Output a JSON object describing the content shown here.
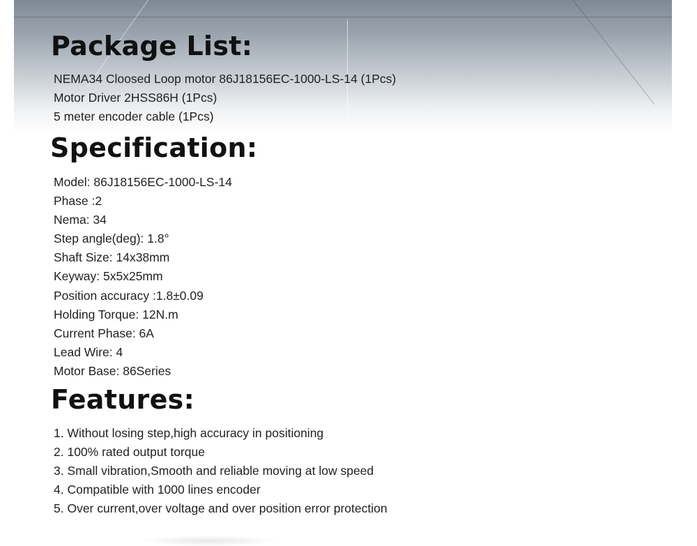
{
  "package": {
    "title": "Package List:",
    "items": [
      "NEMA34 Cloosed Loop motor 86J18156EC-1000-LS-14 (1Pcs)",
      "Motor Driver 2HSS86H (1Pcs)",
      "5 meter encoder cable (1Pcs)"
    ]
  },
  "specification": {
    "title": "Specification:",
    "items": [
      "Model: 86J18156EC-1000-LS-14",
      "Phase :2",
      "Nema: 34",
      "Step angle(deg): 1.8°",
      "Shaft Size: 14x38mm",
      "Keyway: 5x5x25mm",
      "Position accuracy :1.8±0.09",
      "Holding Torque: 12N.m",
      "Current Phase: 6A",
      "Lead Wire: 4",
      "Motor Base: 86Series"
    ]
  },
  "features": {
    "title": "Features:",
    "items": [
      "1. Without losing step,high accuracy in positioning",
      "2. 100% rated output torque",
      "3. Small vibration,Smooth and reliable moving at low speed",
      "4. Compatible with 1000 lines encoder",
      "5. Over current,over voltage and over position error protection"
    ]
  }
}
